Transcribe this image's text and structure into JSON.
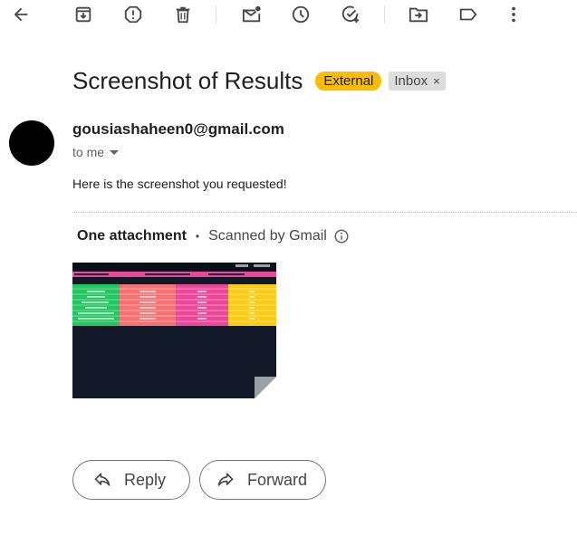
{
  "toolbar": {
    "icons": [
      "back-arrow-icon",
      "archive-icon",
      "report-spam-icon",
      "delete-icon",
      "mark-unread-icon",
      "snooze-icon",
      "add-to-tasks-icon",
      "move-to-icon",
      "label-icon",
      "more-options-icon"
    ]
  },
  "email": {
    "subject": "Screenshot of Results",
    "external_label": "External",
    "inbox_label": "Inbox",
    "inbox_remove": "×",
    "sender_email": "gousiashaheen0@gmail.com",
    "recipient": "to me",
    "body": "Here is the screenshot you requested!"
  },
  "attachment": {
    "title": "One attachment",
    "separator": "•",
    "scan_status": "Scanned by Gmail"
  },
  "actions": {
    "reply": "Reply",
    "forward": "Forward"
  },
  "colors": {
    "external_badge": "#fbbc04",
    "inbox_badge": "#dddddd",
    "thumb_bg": "#111827"
  }
}
